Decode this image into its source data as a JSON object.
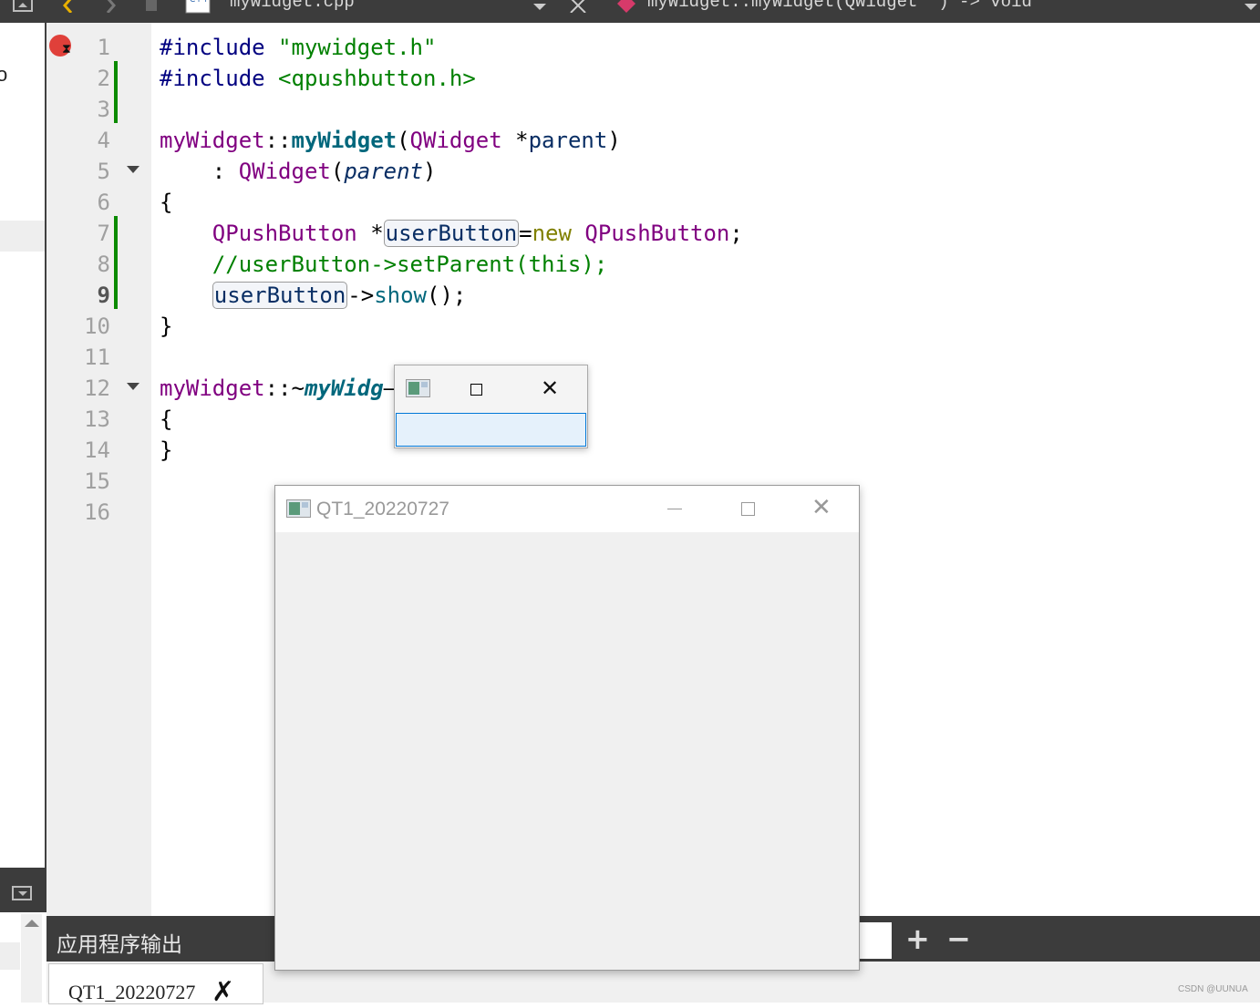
{
  "toolbar": {
    "file_name": "mywidget.cpp",
    "function_crumb": "myWidget::myWidget(QWidget *) -> void"
  },
  "editor": {
    "line_numbers": [
      "1",
      "2",
      "3",
      "4",
      "5",
      "6",
      "7",
      "8",
      "9",
      "10",
      "11",
      "12",
      "13",
      "14",
      "15",
      "16"
    ],
    "current_line": "9",
    "lines": [
      [
        {
          "t": "#include ",
          "c": "pp"
        },
        {
          "t": "\"mywidget.h\"",
          "c": "str"
        }
      ],
      [
        {
          "t": "#include ",
          "c": "pp"
        },
        {
          "t": "<qpushbutton.h>",
          "c": "str"
        }
      ],
      [],
      [
        {
          "t": "myWidget",
          "c": "typ"
        },
        {
          "t": "::",
          "c": ""
        },
        {
          "t": "myWidget",
          "c": "fnb"
        },
        {
          "t": "(",
          "c": ""
        },
        {
          "t": "QWidget",
          "c": "typ"
        },
        {
          "t": " *",
          "c": ""
        },
        {
          "t": "parent",
          "c": "prm"
        },
        {
          "t": ")",
          "c": ""
        }
      ],
      [
        {
          "t": "    : ",
          "c": ""
        },
        {
          "t": "QWidget",
          "c": "typ"
        },
        {
          "t": "(",
          "c": ""
        },
        {
          "t": "parent",
          "c": "prm ital"
        },
        {
          "t": ")",
          "c": ""
        }
      ],
      [
        {
          "t": "{",
          "c": ""
        }
      ],
      [
        {
          "t": "    ",
          "c": ""
        },
        {
          "t": "QPushButton",
          "c": "typ"
        },
        {
          "t": " *",
          "c": ""
        },
        {
          "t": "userButton",
          "c": "prm hl"
        },
        {
          "t": "=",
          "c": ""
        },
        {
          "t": "new",
          "c": "kw"
        },
        {
          "t": " ",
          "c": ""
        },
        {
          "t": "QPushButton",
          "c": "typ"
        },
        {
          "t": ";",
          "c": ""
        }
      ],
      [
        {
          "t": "    //userButton->setParent(this);",
          "c": "com"
        }
      ],
      [
        {
          "t": "    ",
          "c": ""
        },
        {
          "t": "userButton",
          "c": "prm hl"
        },
        {
          "t": "->",
          "c": ""
        },
        {
          "t": "show",
          "c": "fn"
        },
        {
          "t": "();",
          "c": ""
        }
      ],
      [
        {
          "t": "}",
          "c": ""
        }
      ],
      [],
      [
        {
          "t": "myWidget",
          "c": "typ"
        },
        {
          "t": "::~",
          "c": ""
        },
        {
          "t": "myWidg",
          "c": "fni"
        },
        {
          "t": "—",
          "c": ""
        }
      ],
      [
        {
          "t": "{",
          "c": ""
        }
      ],
      [
        {
          "t": "}",
          "c": ""
        }
      ],
      [],
      []
    ]
  },
  "child_window": {
    "icon": "qt-window-icon",
    "button_label": ""
  },
  "main_window": {
    "title": "QT1_20220727",
    "icon": "qt-window-icon"
  },
  "output_panel": {
    "title": "应用程序输出",
    "tab_label": "QT1_20220727",
    "plus_label": "+",
    "minus_label": "−"
  },
  "watermark": "CSDN @UUNUA",
  "sidebar": {
    "fragment": "o"
  }
}
